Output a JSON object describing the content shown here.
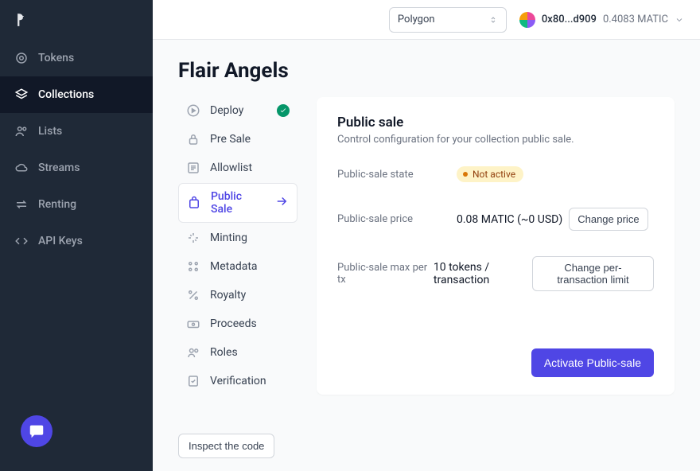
{
  "colors": {
    "accent": "#4f46e5",
    "sidebar": "#1f2937"
  },
  "sidebar": {
    "items": [
      {
        "label": "Tokens"
      },
      {
        "label": "Collections"
      },
      {
        "label": "Lists"
      },
      {
        "label": "Streams"
      },
      {
        "label": "Renting"
      },
      {
        "label": "API Keys"
      }
    ]
  },
  "topbar": {
    "network": "Polygon",
    "wallet_address": "0x80...d909",
    "wallet_balance": "0.4083 MATIC"
  },
  "page": {
    "title": "Flair Angels"
  },
  "subnav": {
    "items": [
      {
        "label": "Deploy"
      },
      {
        "label": "Pre Sale"
      },
      {
        "label": "Allowlist"
      },
      {
        "label": "Public Sale"
      },
      {
        "label": "Minting"
      },
      {
        "label": "Metadata"
      },
      {
        "label": "Royalty"
      },
      {
        "label": "Proceeds"
      },
      {
        "label": "Roles"
      },
      {
        "label": "Verification"
      }
    ]
  },
  "panel": {
    "title": "Public sale",
    "description": "Control configuration for your collection public sale.",
    "fields": {
      "state_label": "Public-sale state",
      "state_value": "Not active",
      "price_label": "Public-sale price",
      "price_value": "0.08 MATIC (~0 USD)",
      "price_button": "Change price",
      "max_label": "Public-sale max per tx",
      "max_value": "10 tokens / transaction",
      "max_button": "Change per-transaction limit"
    },
    "activate_button": "Activate Public-sale"
  },
  "footer": {
    "inspect_button": "Inspect the code"
  }
}
